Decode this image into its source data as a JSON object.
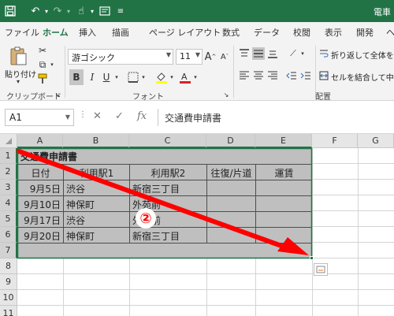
{
  "titlebar": {
    "title": "電車",
    "qa_icons": [
      "save-icon",
      "undo-icon",
      "redo-icon",
      "touch-mode-icon",
      "form-icon"
    ]
  },
  "ribbon_tabs": [
    "ファイル",
    "ホーム",
    "挿入",
    "描画",
    "ページ レイアウト",
    "数式",
    "データ",
    "校閲",
    "表示",
    "開発",
    "ヘ"
  ],
  "active_tab": "ホーム",
  "ribbon": {
    "paste_label": "貼り付け",
    "clipboard_label": "クリップボード",
    "font_label": "フォント",
    "alignment_label": "配置",
    "font_name": "游ゴシック",
    "font_size": "11",
    "bold": "B",
    "italic": "I",
    "underline": "U",
    "grow_font": "A",
    "shrink_font": "A",
    "wrap_text": "折り返して全体を表",
    "merge_center": "セルを結合して中央"
  },
  "formula_bar": {
    "name_box": "A1",
    "fx": "fx",
    "content": "交通費申請書"
  },
  "columns": [
    "A",
    "B",
    "C",
    "D",
    "E",
    "F",
    "G"
  ],
  "rows": [
    "1",
    "2",
    "3",
    "4",
    "5",
    "6",
    "7",
    "8",
    "9",
    "10",
    "11"
  ],
  "sheet": {
    "title": "交通費申請書",
    "headers": [
      "日付",
      "利用駅1",
      "利用駅2",
      "往復/片道",
      "運賃"
    ],
    "records": [
      [
        "9月5日",
        "渋谷",
        "新宿三丁目",
        "",
        ""
      ],
      [
        "9月10日",
        "神保町",
        "外苑前",
        "",
        ""
      ],
      [
        "9月17日",
        "渋谷",
        "外苑前",
        "",
        ""
      ],
      [
        "9月20日",
        "神保町",
        "新宿三丁目",
        "",
        ""
      ]
    ]
  },
  "annotation": {
    "step_number": "②",
    "arrow_color": "#ff0000"
  },
  "colors": {
    "excel_green": "#217346",
    "table_fill": "#bfbfbf"
  }
}
